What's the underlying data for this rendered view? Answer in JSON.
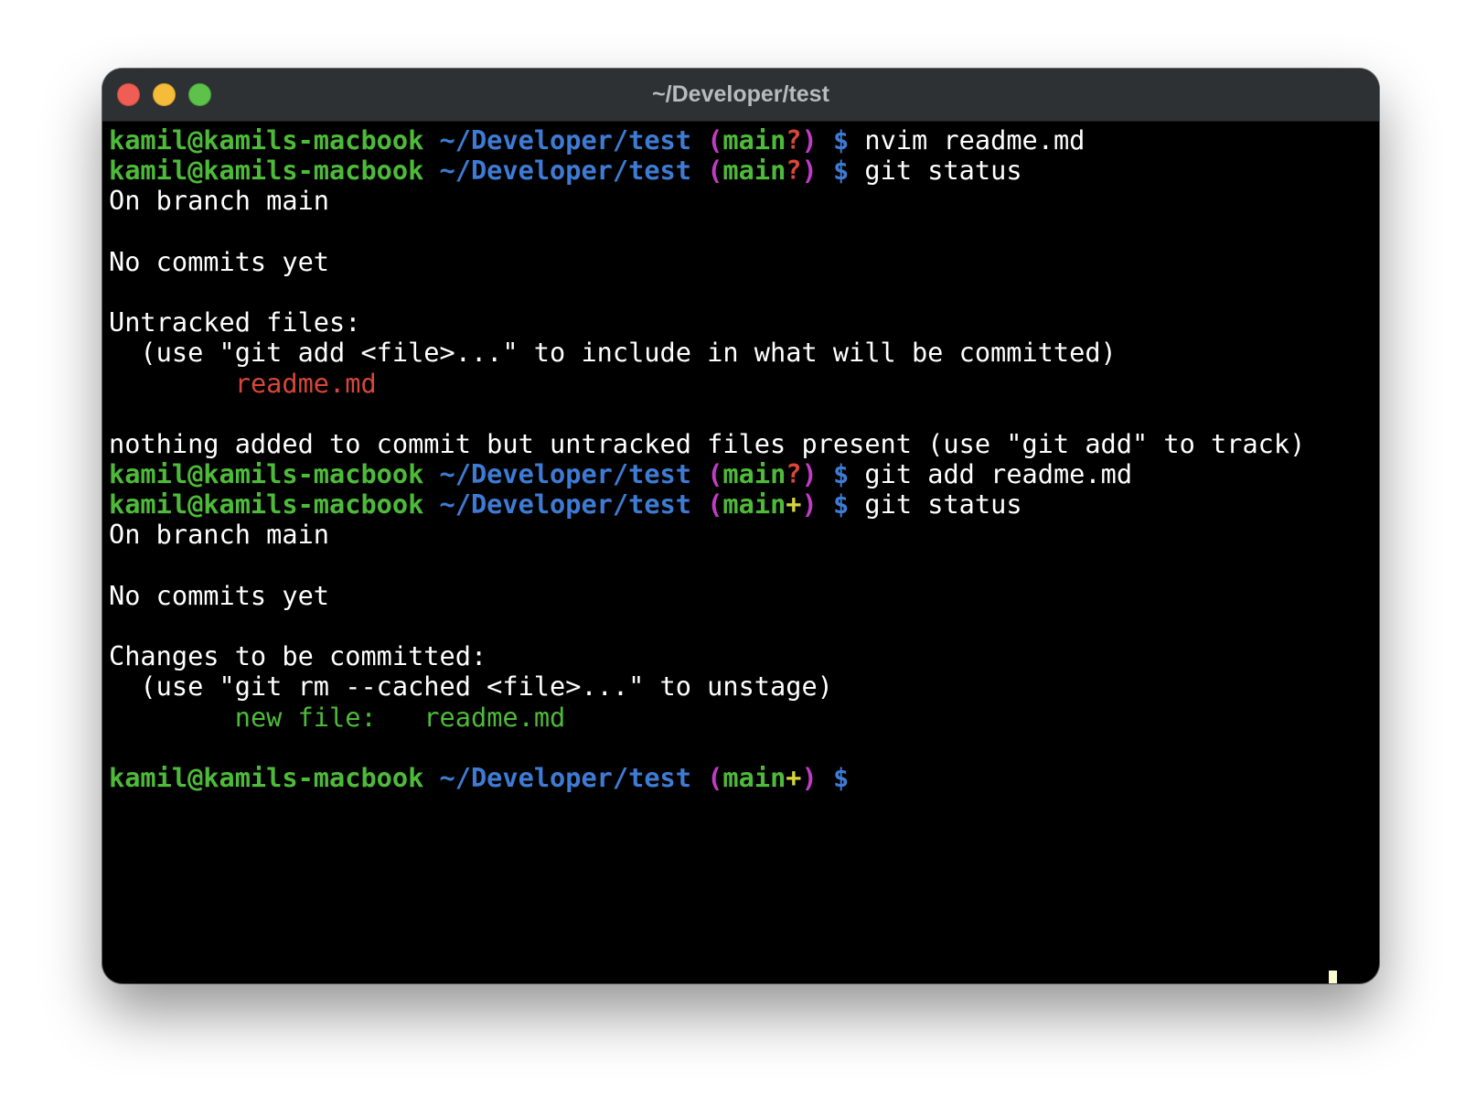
{
  "window": {
    "title": "~/Developer/test"
  },
  "prompt": {
    "user_host": "kamil@kamils-macbook",
    "path": "~/Developer/test",
    "paren_open": "(",
    "branch": "main",
    "paren_close": ")",
    "dollar": "$"
  },
  "lines": {
    "l1": {
      "status_marker": "?",
      "command": "nvim readme.md"
    },
    "l2": {
      "status_marker": "?",
      "command": "git status"
    },
    "l3": {
      "text": "On branch main"
    },
    "l5": {
      "text": "No commits yet"
    },
    "l7": {
      "text": "Untracked files:"
    },
    "l8": {
      "text": "  (use \"git add <file>...\" to include in what will be committed)"
    },
    "l9": {
      "indent": "        ",
      "file": "readme.md"
    },
    "l11": {
      "text": "nothing added to commit but untracked files present (use \"git add\" to track)"
    },
    "l12": {
      "status_marker": "?",
      "command": "git add readme.md"
    },
    "l13": {
      "status_marker": "+",
      "command": "git status"
    },
    "l14": {
      "text": "On branch main"
    },
    "l16": {
      "text": "No commits yet"
    },
    "l18": {
      "text": "Changes to be committed:"
    },
    "l19": {
      "text": "  (use \"git rm --cached <file>...\" to unstage)"
    },
    "l20": {
      "indent": "        ",
      "label": "new file:",
      "gap": "   ",
      "file": "readme.md"
    },
    "l22": {
      "status_marker": "+",
      "command": ""
    }
  },
  "colors": {
    "background": "#000000",
    "titlebar": "#2e3133",
    "user_host": "#4eba3a",
    "path": "#3e7bd4",
    "paren": "#c33bc6",
    "dirty_marker": "#d8473a",
    "staged_marker": "#d6d53d",
    "untracked_file": "#d8473a",
    "staged_file": "#4eba3a",
    "cursor": "#fdf9d0"
  }
}
